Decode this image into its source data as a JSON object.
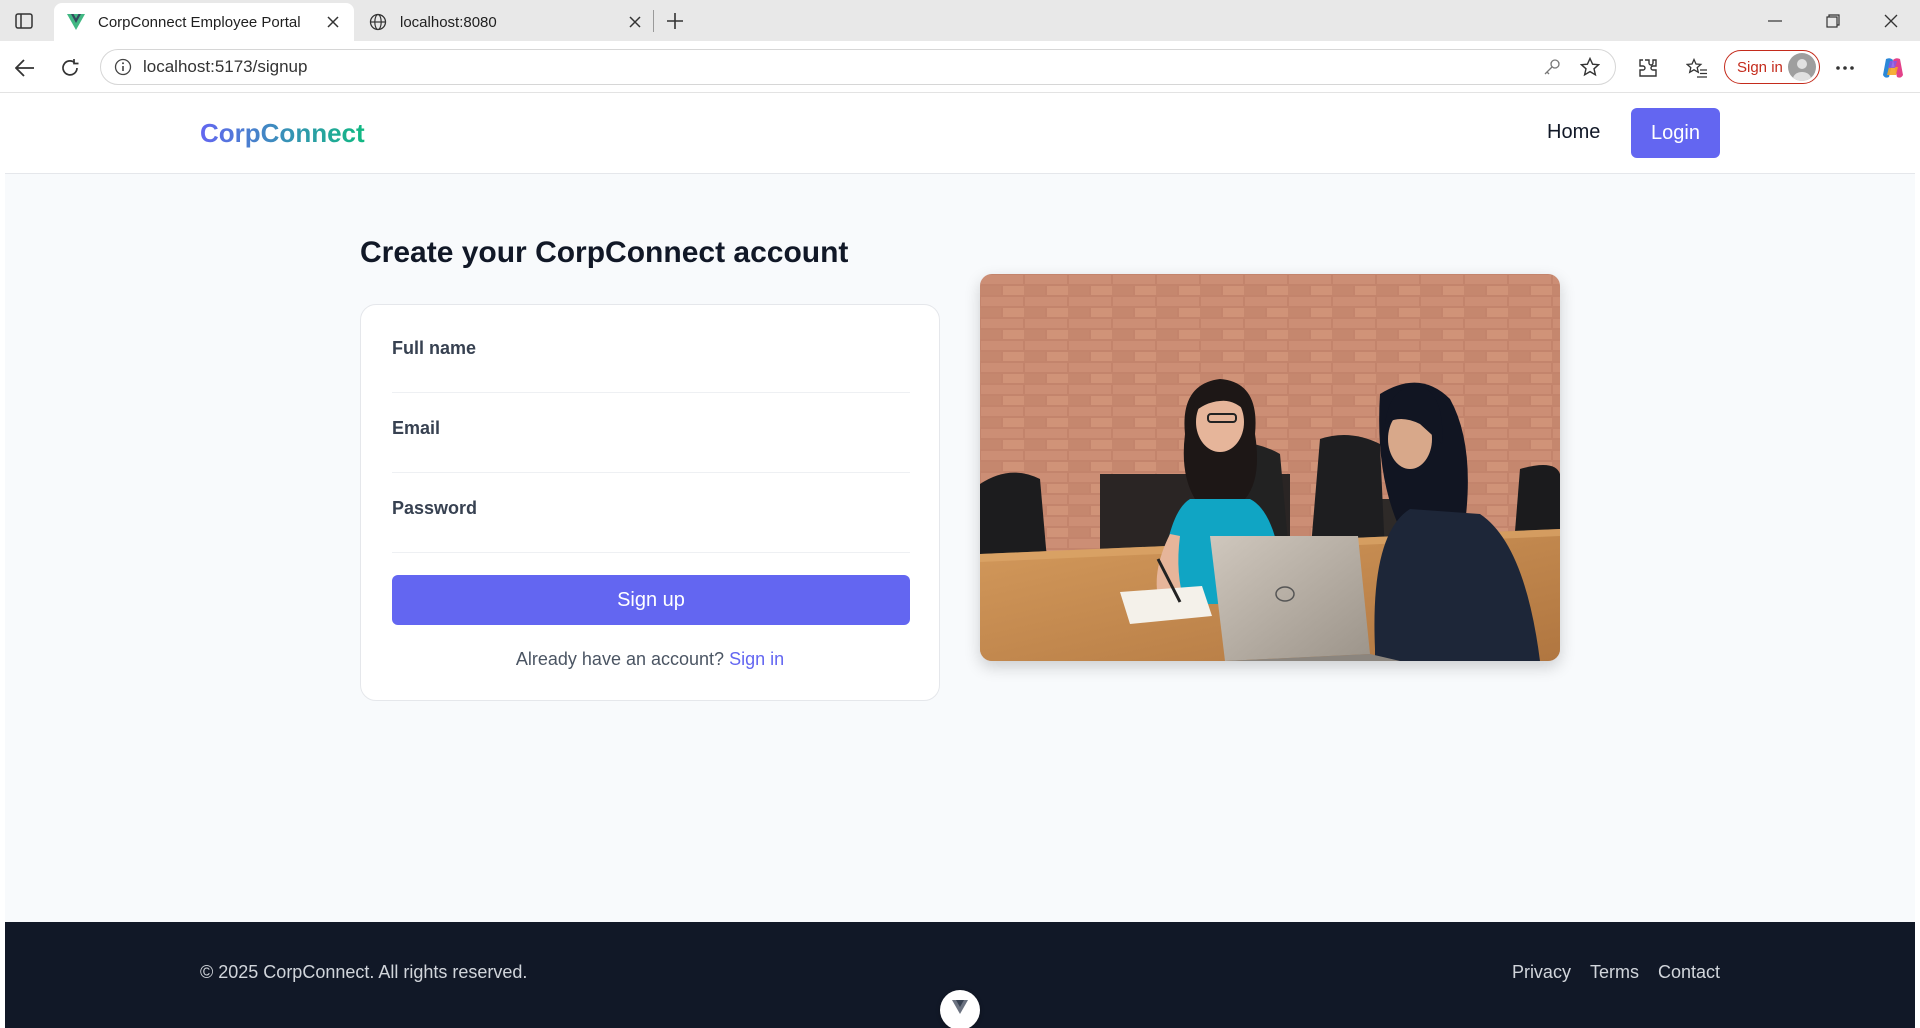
{
  "browser": {
    "tabs": [
      {
        "title": "CorpConnect Employee Portal",
        "active": true,
        "favicon": "vue-icon"
      },
      {
        "title": "localhost:8080",
        "active": false,
        "favicon": "globe-icon"
      }
    ],
    "url": "localhost:5173/signup",
    "profile_label": "Sign in",
    "accent_color": "#c42b1c"
  },
  "header": {
    "brand": "CorpConnect",
    "nav": {
      "home": "Home",
      "login": "Login"
    }
  },
  "signup": {
    "title": "Create your CorpConnect account",
    "fields": [
      {
        "label": "Full name",
        "value": "",
        "type": "text"
      },
      {
        "label": "Email",
        "value": "",
        "type": "email"
      },
      {
        "label": "Password",
        "value": "",
        "type": "password"
      }
    ],
    "submit_label": "Sign up",
    "already_text": "Already have an account?",
    "signin_link": "Sign in"
  },
  "hero": {
    "description_icon": "office-meeting-photo"
  },
  "footer": {
    "copyright": "© 2025 CorpConnect. All rights reserved.",
    "links": [
      "Privacy",
      "Terms",
      "Contact"
    ]
  },
  "colors": {
    "primary": "#6366f1",
    "brand_gradient_start": "#6366f1",
    "brand_gradient_end": "#10b981",
    "footer_bg": "#111827",
    "page_bg": "#f8fafc"
  }
}
